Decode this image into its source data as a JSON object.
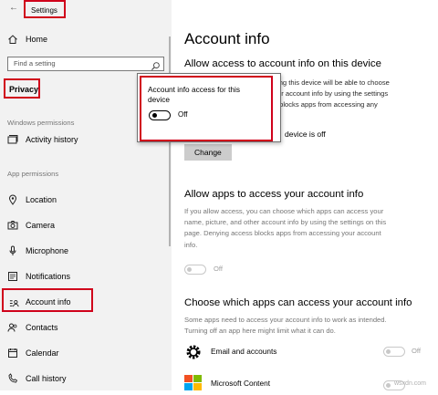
{
  "window": {
    "title": "Settings",
    "back_glyph": "←"
  },
  "sidebar": {
    "home": "Home",
    "search_placeholder": "Find a setting",
    "section": "Privacy",
    "windows_permissions": "Windows permissions",
    "activity_history": "Activity history",
    "app_permissions": "App permissions",
    "items": [
      "Location",
      "Camera",
      "Microphone",
      "Notifications",
      "Account info",
      "Contacts",
      "Calendar",
      "Call history"
    ]
  },
  "main": {
    "title": "Account info",
    "section1": {
      "heading": "Allow access to account info on this device",
      "desc_lines": [
        "using this device will be able to choose",
        "their account info by using the settings",
        "es blocks apps from accessing any"
      ],
      "status_partial": "device is off",
      "change_button": "Change"
    },
    "section2": {
      "heading": "Allow apps to access your account info",
      "desc_lines": [
        "If you allow access, you can choose which apps can access your",
        "name, picture, and other account info by using the settings on this",
        "page. Denying access blocks apps from accessing your account",
        "info."
      ],
      "toggle_label": "Off"
    },
    "section3": {
      "heading": "Choose which apps can access your account info",
      "desc_lines": [
        "Some apps need to access your account info to work as intended.",
        "Turning off an app here might limit what it can do."
      ],
      "apps": [
        {
          "name": "Email and accounts",
          "toggle_label": "Off"
        },
        {
          "name": "Microsoft Content",
          "toggle_label": ""
        }
      ]
    }
  },
  "popup": {
    "title_lines": [
      "Account info access for this",
      "device"
    ],
    "toggle_label": "Off"
  },
  "watermark": "wsxdn.com",
  "colors": {
    "highlight_red": "#d0021b",
    "sidebar_bg": "#f2f2f2",
    "button_bg": "#cccccc"
  }
}
